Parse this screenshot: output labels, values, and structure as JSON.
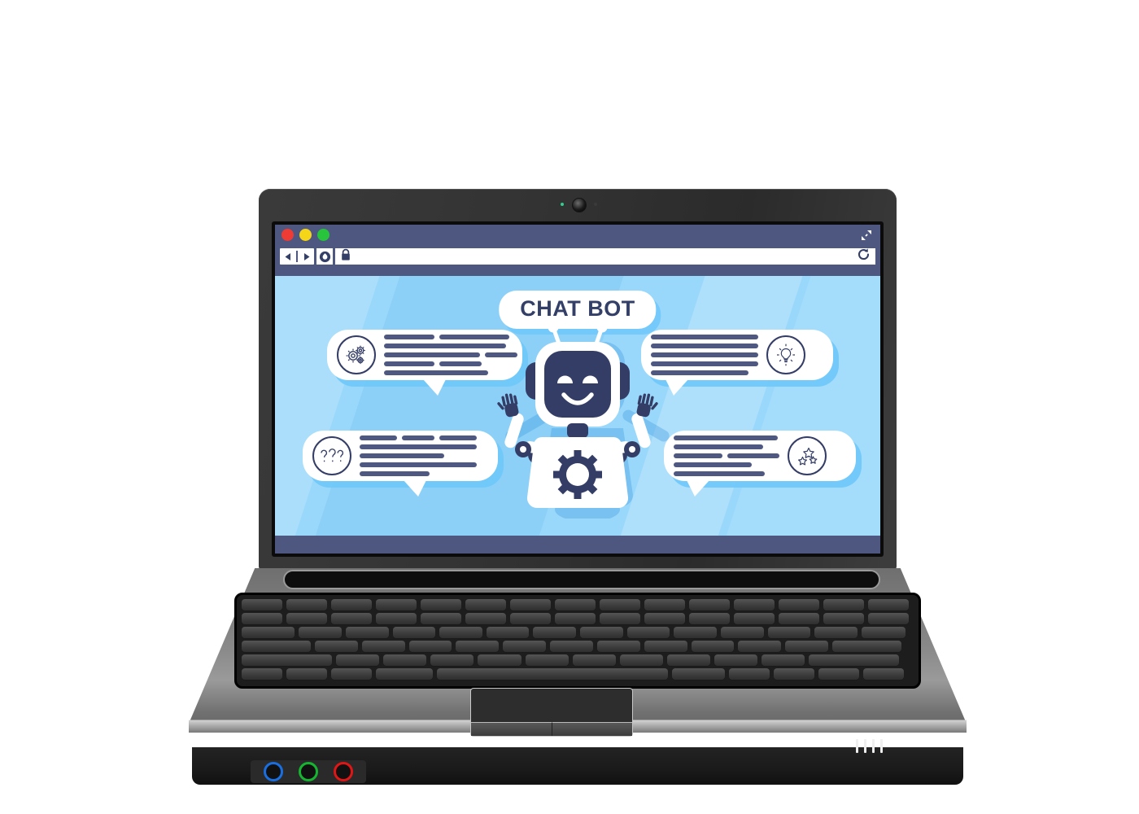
{
  "device": {
    "type": "laptop",
    "webcam": "webcam-lens",
    "indicator_led_color": "#2ecf8f",
    "audio_jacks": [
      {
        "name": "line-out-jack",
        "color": "#1a6fe0"
      },
      {
        "name": "microphone-jack",
        "color": "#16b531"
      },
      {
        "name": "headphone-jack",
        "color": "#e01616"
      }
    ],
    "status_led_count": 4,
    "keyboard_rows": [
      15,
      15,
      14,
      13,
      12,
      10
    ],
    "trackpad_buttons": 2
  },
  "browser": {
    "chrome_color": "#4e5780",
    "window_controls": [
      {
        "name": "close-button",
        "color": "#ee3b33"
      },
      {
        "name": "minimize-button",
        "color": "#f5d517"
      },
      {
        "name": "maximize-button",
        "color": "#27c43c"
      }
    ],
    "expand_icon": "expand-fullscreen-icon",
    "toolbar": {
      "back_icon": "back-arrow-icon",
      "forward_icon": "forward-arrow-icon",
      "downloads_icon": "download-shield-icon",
      "lock_icon": "padlock-icon",
      "reload_icon": "reload-icon"
    },
    "address_bar": {
      "value": "",
      "placeholder": ""
    }
  },
  "page": {
    "background_color": "#9ad8fb",
    "accent_shadow_color": "#6ec8fa",
    "text_bar_color": "#4f5880",
    "ink_color": "#343d66",
    "title": "CHAT BOT",
    "footer_bar_color": "#4e5780",
    "mascot": {
      "name": "chat-bot-robot",
      "face_color": "#343d66",
      "shell_color": "#ffffff",
      "emblem": "gear-icon",
      "expression": "smiling",
      "antennae": 2,
      "hands": 2
    },
    "bubbles": [
      {
        "id": "bubble-top-left",
        "icon": "gears-icon",
        "icon_side": "left",
        "tail": "bottom-right",
        "lines": [
          [
            62,
            86
          ],
          [
            150
          ],
          [
            118,
            40
          ],
          [
            62,
            52
          ],
          [
            128
          ]
        ]
      },
      {
        "id": "bubble-top-right",
        "icon": "lightbulb-icon",
        "icon_side": "right",
        "tail": "bottom-left",
        "lines": [
          [
            132
          ],
          [
            132
          ],
          [
            132
          ],
          [
            132
          ],
          [
            120
          ]
        ]
      },
      {
        "id": "bubble-bottom-left",
        "icon": "question-marks-icon",
        "icon_side": "left",
        "tail": "bottom-right",
        "lines": [
          [
            46,
            40,
            46
          ],
          [
            144
          ],
          [
            104
          ],
          [
            144
          ],
          [
            86
          ]
        ]
      },
      {
        "id": "bubble-bottom-right",
        "icon": "stars-icon",
        "icon_side": "right",
        "tail": "bottom-left",
        "lines": [
          [
            128
          ],
          [
            110
          ],
          [
            60,
            64
          ],
          [
            96
          ],
          [
            112
          ]
        ]
      }
    ]
  }
}
